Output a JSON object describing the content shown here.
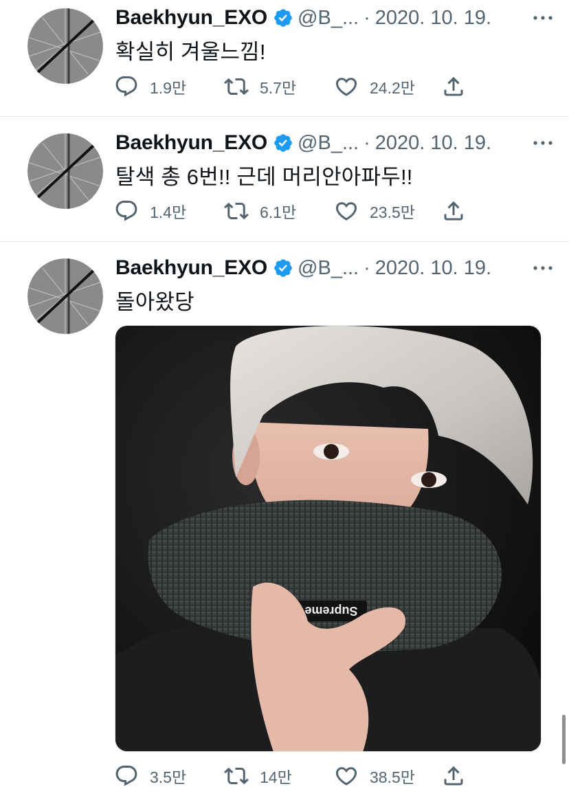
{
  "tweets": [
    {
      "name": "Baekhyun_EXO",
      "handle": "@B_...",
      "separator": "·",
      "date": "2020. 10. 19.",
      "text": "확실히 겨울느낌!",
      "replies": "1.9만",
      "retweets": "5.7만",
      "likes": "24.2만"
    },
    {
      "name": "Baekhyun_EXO",
      "handle": "@B_...",
      "separator": "·",
      "date": "2020. 10. 19.",
      "text": "탈색 총 6번!! 근데 머리안아파두!!",
      "replies": "1.4만",
      "retweets": "6.1만",
      "likes": "23.5만"
    },
    {
      "name": "Baekhyun_EXO",
      "handle": "@B_...",
      "separator": "·",
      "date": "2020. 10. 19.",
      "text": "돌아왔당",
      "media_description": "selfie photo",
      "media_brand_text": "Supreme",
      "replies": "3.5만",
      "retweets": "14만",
      "likes": "38.5만"
    }
  ],
  "colors": {
    "text_primary": "#0f1419",
    "text_secondary": "#536471",
    "verified_blue": "#1d9bf0",
    "divider": "#e1e6ea",
    "avatar_gray": "#8a8a8a"
  },
  "icons": {
    "reply": "reply-icon",
    "retweet": "retweet-icon",
    "like": "heart-icon",
    "share": "share-icon",
    "verified": "verified-badge-icon",
    "more": "more-icon"
  }
}
